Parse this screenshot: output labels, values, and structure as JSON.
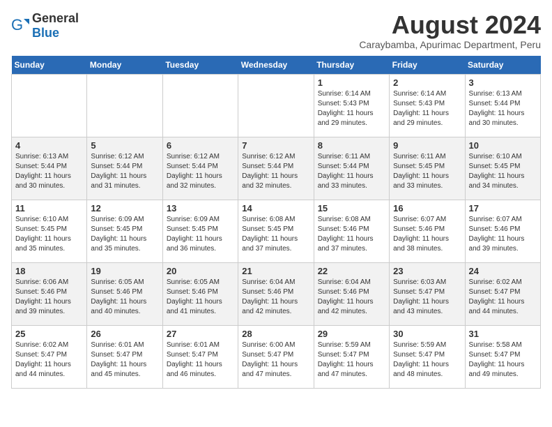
{
  "header": {
    "logo_general": "General",
    "logo_blue": "Blue",
    "title": "August 2024",
    "subtitle": "Caraybamba, Apurimac Department, Peru"
  },
  "calendar": {
    "days_of_week": [
      "Sunday",
      "Monday",
      "Tuesday",
      "Wednesday",
      "Thursday",
      "Friday",
      "Saturday"
    ],
    "weeks": [
      [
        {
          "day": "",
          "info": ""
        },
        {
          "day": "",
          "info": ""
        },
        {
          "day": "",
          "info": ""
        },
        {
          "day": "",
          "info": ""
        },
        {
          "day": "1",
          "info": "Sunrise: 6:14 AM\nSunset: 5:43 PM\nDaylight: 11 hours\nand 29 minutes."
        },
        {
          "day": "2",
          "info": "Sunrise: 6:14 AM\nSunset: 5:43 PM\nDaylight: 11 hours\nand 29 minutes."
        },
        {
          "day": "3",
          "info": "Sunrise: 6:13 AM\nSunset: 5:44 PM\nDaylight: 11 hours\nand 30 minutes."
        }
      ],
      [
        {
          "day": "4",
          "info": "Sunrise: 6:13 AM\nSunset: 5:44 PM\nDaylight: 11 hours\nand 30 minutes."
        },
        {
          "day": "5",
          "info": "Sunrise: 6:12 AM\nSunset: 5:44 PM\nDaylight: 11 hours\nand 31 minutes."
        },
        {
          "day": "6",
          "info": "Sunrise: 6:12 AM\nSunset: 5:44 PM\nDaylight: 11 hours\nand 32 minutes."
        },
        {
          "day": "7",
          "info": "Sunrise: 6:12 AM\nSunset: 5:44 PM\nDaylight: 11 hours\nand 32 minutes."
        },
        {
          "day": "8",
          "info": "Sunrise: 6:11 AM\nSunset: 5:44 PM\nDaylight: 11 hours\nand 33 minutes."
        },
        {
          "day": "9",
          "info": "Sunrise: 6:11 AM\nSunset: 5:45 PM\nDaylight: 11 hours\nand 33 minutes."
        },
        {
          "day": "10",
          "info": "Sunrise: 6:10 AM\nSunset: 5:45 PM\nDaylight: 11 hours\nand 34 minutes."
        }
      ],
      [
        {
          "day": "11",
          "info": "Sunrise: 6:10 AM\nSunset: 5:45 PM\nDaylight: 11 hours\nand 35 minutes."
        },
        {
          "day": "12",
          "info": "Sunrise: 6:09 AM\nSunset: 5:45 PM\nDaylight: 11 hours\nand 35 minutes."
        },
        {
          "day": "13",
          "info": "Sunrise: 6:09 AM\nSunset: 5:45 PM\nDaylight: 11 hours\nand 36 minutes."
        },
        {
          "day": "14",
          "info": "Sunrise: 6:08 AM\nSunset: 5:45 PM\nDaylight: 11 hours\nand 37 minutes."
        },
        {
          "day": "15",
          "info": "Sunrise: 6:08 AM\nSunset: 5:46 PM\nDaylight: 11 hours\nand 37 minutes."
        },
        {
          "day": "16",
          "info": "Sunrise: 6:07 AM\nSunset: 5:46 PM\nDaylight: 11 hours\nand 38 minutes."
        },
        {
          "day": "17",
          "info": "Sunrise: 6:07 AM\nSunset: 5:46 PM\nDaylight: 11 hours\nand 39 minutes."
        }
      ],
      [
        {
          "day": "18",
          "info": "Sunrise: 6:06 AM\nSunset: 5:46 PM\nDaylight: 11 hours\nand 39 minutes."
        },
        {
          "day": "19",
          "info": "Sunrise: 6:05 AM\nSunset: 5:46 PM\nDaylight: 11 hours\nand 40 minutes."
        },
        {
          "day": "20",
          "info": "Sunrise: 6:05 AM\nSunset: 5:46 PM\nDaylight: 11 hours\nand 41 minutes."
        },
        {
          "day": "21",
          "info": "Sunrise: 6:04 AM\nSunset: 5:46 PM\nDaylight: 11 hours\nand 42 minutes."
        },
        {
          "day": "22",
          "info": "Sunrise: 6:04 AM\nSunset: 5:46 PM\nDaylight: 11 hours\nand 42 minutes."
        },
        {
          "day": "23",
          "info": "Sunrise: 6:03 AM\nSunset: 5:47 PM\nDaylight: 11 hours\nand 43 minutes."
        },
        {
          "day": "24",
          "info": "Sunrise: 6:02 AM\nSunset: 5:47 PM\nDaylight: 11 hours\nand 44 minutes."
        }
      ],
      [
        {
          "day": "25",
          "info": "Sunrise: 6:02 AM\nSunset: 5:47 PM\nDaylight: 11 hours\nand 44 minutes."
        },
        {
          "day": "26",
          "info": "Sunrise: 6:01 AM\nSunset: 5:47 PM\nDaylight: 11 hours\nand 45 minutes."
        },
        {
          "day": "27",
          "info": "Sunrise: 6:01 AM\nSunset: 5:47 PM\nDaylight: 11 hours\nand 46 minutes."
        },
        {
          "day": "28",
          "info": "Sunrise: 6:00 AM\nSunset: 5:47 PM\nDaylight: 11 hours\nand 47 minutes."
        },
        {
          "day": "29",
          "info": "Sunrise: 5:59 AM\nSunset: 5:47 PM\nDaylight: 11 hours\nand 47 minutes."
        },
        {
          "day": "30",
          "info": "Sunrise: 5:59 AM\nSunset: 5:47 PM\nDaylight: 11 hours\nand 48 minutes."
        },
        {
          "day": "31",
          "info": "Sunrise: 5:58 AM\nSunset: 5:47 PM\nDaylight: 11 hours\nand 49 minutes."
        }
      ]
    ]
  }
}
